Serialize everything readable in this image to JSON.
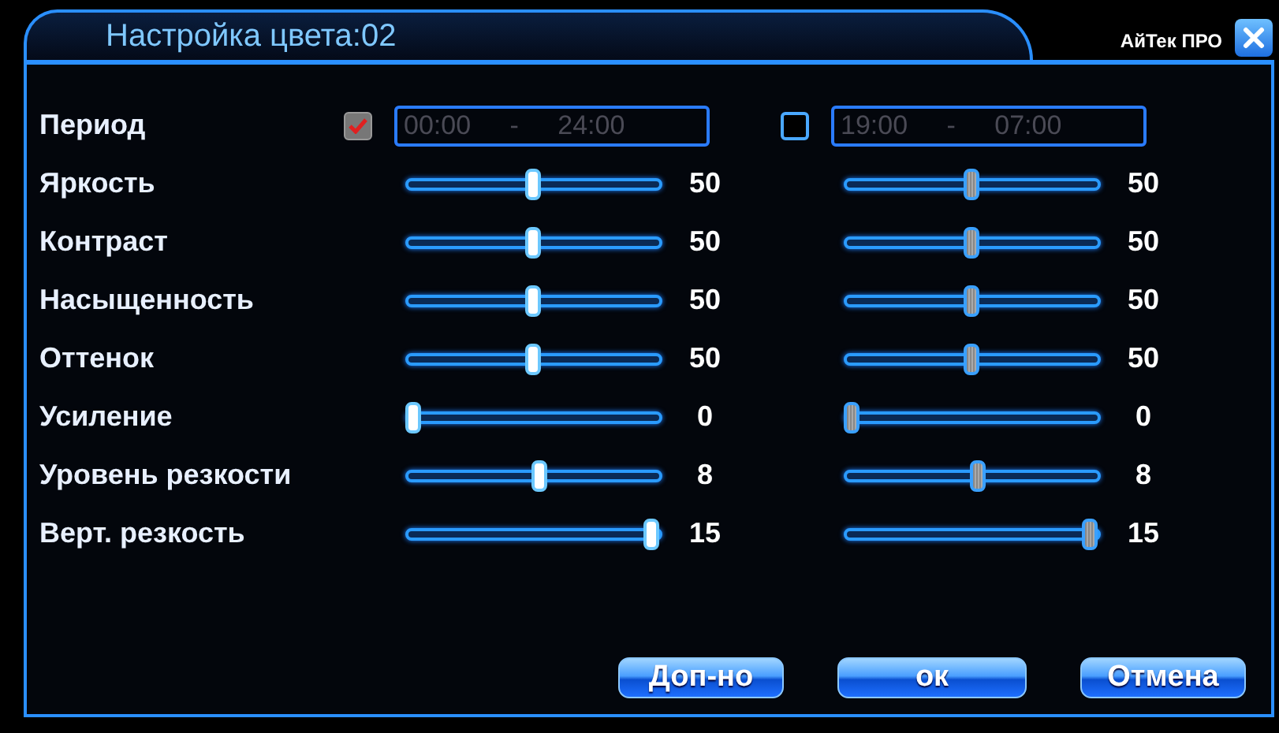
{
  "window": {
    "title": "Настройка цвета:02",
    "brand": "АйТек ПРО"
  },
  "period": {
    "label": "Период",
    "profiles": [
      {
        "checked": true,
        "time": "00:00 - 24:00"
      },
      {
        "checked": false,
        "time": "19:00 - 07:00"
      }
    ]
  },
  "rows": [
    {
      "label": "Яркость",
      "values": [
        {
          "level": 0.5,
          "reading": "50"
        },
        {
          "level": 0.5,
          "reading": "50"
        }
      ]
    },
    {
      "label": "Контраст",
      "values": [
        {
          "level": 0.5,
          "reading": "50"
        },
        {
          "level": 0.5,
          "reading": "50"
        }
      ]
    },
    {
      "label": "Насыщенность",
      "values": [
        {
          "level": 0.5,
          "reading": "50"
        },
        {
          "level": 0.5,
          "reading": "50"
        }
      ]
    },
    {
      "label": "Оттенок",
      "values": [
        {
          "level": 0.5,
          "reading": "50"
        },
        {
          "level": 0.5,
          "reading": "50"
        }
      ]
    },
    {
      "label": "Усиление",
      "values": [
        {
          "level": 0,
          "reading": "0"
        },
        {
          "level": 0,
          "reading": "0"
        }
      ]
    },
    {
      "label": "Уровень резкости",
      "values": [
        {
          "level": 0.53,
          "reading": "8"
        },
        {
          "level": 0.53,
          "reading": "8"
        }
      ]
    },
    {
      "label": "Верт. резкость",
      "values": [
        {
          "level": 1,
          "reading": "15"
        },
        {
          "level": 1,
          "reading": "15"
        }
      ]
    }
  ],
  "buttons": [
    "Доп-но",
    "ок",
    "Отмена"
  ]
}
